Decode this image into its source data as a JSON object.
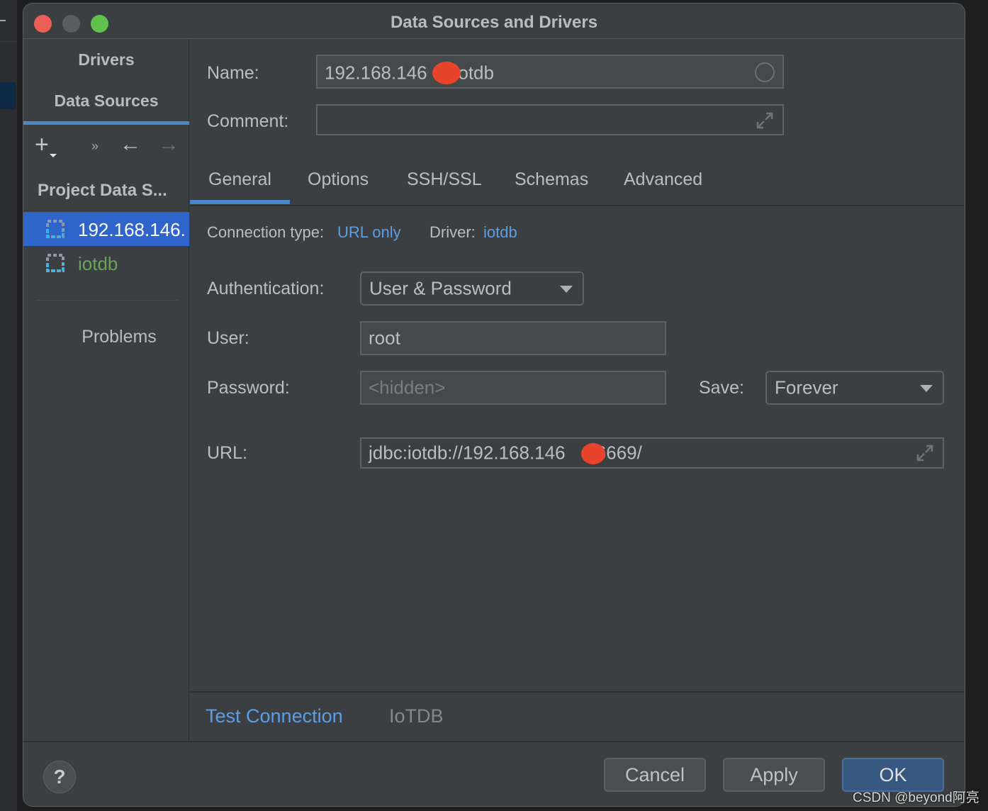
{
  "window": {
    "title": "Data Sources and Drivers"
  },
  "sidebar": {
    "tabs": [
      {
        "label": "Drivers"
      },
      {
        "label": "Data Sources"
      }
    ],
    "group_label": "Project Data S...",
    "items": [
      {
        "label": "192.168.146.",
        "selected": true,
        "icon": "database-icon"
      },
      {
        "label": "iotdb",
        "selected": false,
        "icon": "database-icon"
      }
    ],
    "problems_label": "Problems",
    "toolbar": {
      "add": "+",
      "more": "»",
      "back": "←",
      "forward": "→"
    }
  },
  "form": {
    "name_label": "Name:",
    "name_value": "192.168.146.  iotdb",
    "name_value_prefix": "192.168.146",
    "name_value_suffix": "iotdb",
    "comment_label": "Comment:",
    "comment_value": "",
    "tabs": [
      {
        "label": "General",
        "active": true
      },
      {
        "label": "Options",
        "active": false
      },
      {
        "label": "SSH/SSL",
        "active": false
      },
      {
        "label": "Schemas",
        "active": false
      },
      {
        "label": "Advanced",
        "active": false
      }
    ],
    "connection_type_label": "Connection type:",
    "connection_type_value": "URL only",
    "driver_label": "Driver:",
    "driver_value": "iotdb",
    "authentication_label": "Authentication:",
    "authentication_value": "User & Password",
    "user_label": "User:",
    "user_value": "root",
    "password_label": "Password:",
    "password_placeholder": "<hidden>",
    "save_label": "Save:",
    "save_value": "Forever",
    "url_label": "URL:",
    "url_prefix": "jdbc:iotdb://192.168.146",
    "url_suffix": ":6669/"
  },
  "footer": {
    "test_connection": "Test Connection",
    "driver_name": "IoTDB"
  },
  "buttons": {
    "help": "?",
    "cancel": "Cancel",
    "apply": "Apply",
    "ok": "OK"
  },
  "watermark": "CSDN @beyond阿亮",
  "colors": {
    "accent": "#4a88c7",
    "selection": "#2f65ca",
    "link": "#5c9ee6",
    "ok_button": "#365880",
    "redaction": "#e8432b",
    "green_item": "#6aa35d"
  }
}
